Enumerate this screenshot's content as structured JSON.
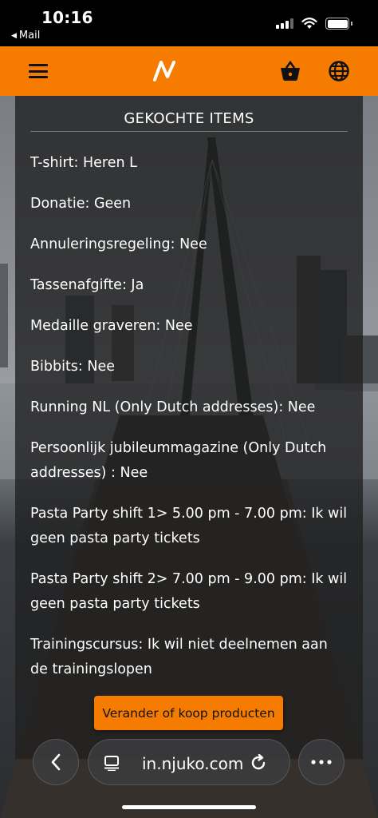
{
  "status_bar": {
    "time": "10:16",
    "back_app_label": "Mail",
    "back_arrow_glyph": "◀"
  },
  "header": {
    "logo_icon": "njuko-logo-icon",
    "menu_icon": "hamburger-menu-icon",
    "basket_icon": "basket-icon",
    "language_icon": "globe-icon",
    "accent_color": "#f57c00"
  },
  "panel": {
    "title": "GEKOCHTE ITEMS",
    "items": [
      "T-shirt: Heren L",
      "Donatie: Geen",
      "Annuleringsregeling: Nee",
      "Tassenafgifte: Ja",
      "Medaille graveren: Nee",
      "Bibbits: Nee",
      "Running NL (Only Dutch addresses): Nee",
      "Persoonlijk jubileummagazine (Only Dutch addresses) : Nee",
      "Pasta Party shift 1> 5.00 pm - 7.00 pm: Ik wil geen pasta party tickets",
      "Pasta Party shift 2> 7.00 pm - 9.00 pm: Ik wil geen pasta party tickets",
      "Trainingscursus: Ik wil niet deelnemen aan de trainingslopen"
    ],
    "cta_label": "Verander of koop producten"
  },
  "browser": {
    "url": "in.njuko.com",
    "back_icon": "chevron-left-icon",
    "reader_icon": "reader-mode-icon",
    "reload_icon": "reload-icon",
    "more_icon": "more-dots-icon"
  }
}
